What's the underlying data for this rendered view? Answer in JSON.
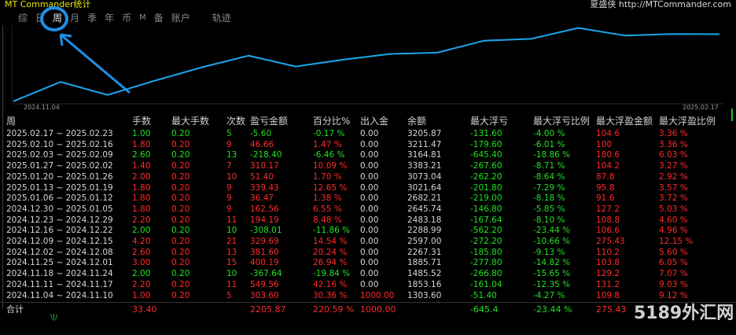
{
  "header": {
    "app_title": "MT Commander统计",
    "vendor": "夏盛侠 http://MTCommander.com"
  },
  "tabs": [
    {
      "label": "综",
      "active": false
    },
    {
      "label": "日",
      "active": false
    },
    {
      "label": "周",
      "active": true
    },
    {
      "label": "月",
      "active": false
    },
    {
      "label": "季",
      "active": false
    },
    {
      "label": "年",
      "active": false
    },
    {
      "label": "币",
      "active": false
    },
    {
      "label": "M",
      "active": false
    },
    {
      "label": "备",
      "active": false
    },
    {
      "label": "账户",
      "active": false
    },
    {
      "label": "轨迹",
      "active": false
    }
  ],
  "chart": {
    "start_date": "2024.11.04",
    "end_date": "2025.02.17",
    "line_color": "#1aa7ec",
    "values": [
      1303.6,
      1853.16,
      1485.52,
      1885.71,
      2267.31,
      2597.0,
      2288.99,
      2483.18,
      2645.74,
      2682.21,
      3021.64,
      3073.04,
      3383.21,
      3164.81,
      3211.47,
      3205.87
    ]
  },
  "table": {
    "columns": [
      "周",
      "手数",
      "最大手数",
      "次数",
      "盈亏金额",
      "百分比%",
      "出入金",
      "余额",
      "最大浮亏",
      "最大浮亏比例",
      "最大浮盈金额",
      "最大浮盈比例"
    ],
    "rows": [
      {
        "week": "2025.02.17 ~ 2025.02.23",
        "lots": "1.00",
        "max_lots": "0.20",
        "count": "5",
        "pnl": "-5.60",
        "pct": "-0.17 %",
        "flow": "0.00",
        "balance": "3205.87",
        "max_dd": "-131.60",
        "dd_pct": "-4.00 %",
        "max_fp": "104.6",
        "fp_pct": "3.36 %",
        "sign": "neg"
      },
      {
        "week": "2025.02.10 ~ 2025.02.16",
        "lots": "1.80",
        "max_lots": "0.20",
        "count": "9",
        "pnl": "46.66",
        "pct": "1.47 %",
        "flow": "0.00",
        "balance": "3211.47",
        "max_dd": "-179.60",
        "dd_pct": "-6.01 %",
        "max_fp": "100",
        "fp_pct": "3.36 %",
        "sign": "pos"
      },
      {
        "week": "2025.02.03 ~ 2025.02.09",
        "lots": "2.60",
        "max_lots": "0.20",
        "count": "13",
        "pnl": "-218.40",
        "pct": "-6.46 %",
        "flow": "0.00",
        "balance": "3164.81",
        "max_dd": "-645.40",
        "dd_pct": "-18.86 %",
        "max_fp": "180.6",
        "fp_pct": "6.03 %",
        "sign": "neg"
      },
      {
        "week": "2025.01.27 ~ 2025.02.02",
        "lots": "1.40",
        "max_lots": "0.20",
        "count": "7",
        "pnl": "310.17",
        "pct": "10.09 %",
        "flow": "0.00",
        "balance": "3383.21",
        "max_dd": "-267.60",
        "dd_pct": "-8.71 %",
        "max_fp": "104.2",
        "fp_pct": "3.27 %",
        "sign": "pos"
      },
      {
        "week": "2025.01.20 ~ 2025.01.26",
        "lots": "2.00",
        "max_lots": "0.20",
        "count": "10",
        "pnl": "51.40",
        "pct": "1.70 %",
        "flow": "0.00",
        "balance": "3073.04",
        "max_dd": "-262.20",
        "dd_pct": "-8.64 %",
        "max_fp": "87.8",
        "fp_pct": "2.92 %",
        "sign": "pos"
      },
      {
        "week": "2025.01.13 ~ 2025.01.19",
        "lots": "1.80",
        "max_lots": "0.20",
        "count": "9",
        "pnl": "339.43",
        "pct": "12.65 %",
        "flow": "0.00",
        "balance": "3021.64",
        "max_dd": "-201.80",
        "dd_pct": "-7.29 %",
        "max_fp": "95.8",
        "fp_pct": "3.57 %",
        "sign": "pos"
      },
      {
        "week": "2025.01.06 ~ 2025.01.12",
        "lots": "1.80",
        "max_lots": "0.20",
        "count": "9",
        "pnl": "36.47",
        "pct": "1.38 %",
        "flow": "0.00",
        "balance": "2682.21",
        "max_dd": "-219.00",
        "dd_pct": "-8.18 %",
        "max_fp": "91.6",
        "fp_pct": "3.72 %",
        "sign": "pos"
      },
      {
        "week": "2024.12.30 ~ 2025.01.05",
        "lots": "1.80",
        "max_lots": "0.20",
        "count": "9",
        "pnl": "162.56",
        "pct": "6.55 %",
        "flow": "0.00",
        "balance": "2645.74",
        "max_dd": "-146.80",
        "dd_pct": "-5.85 %",
        "max_fp": "127.2",
        "fp_pct": "5.03 %",
        "sign": "pos"
      },
      {
        "week": "2024.12.23 ~ 2024.12.29",
        "lots": "2.20",
        "max_lots": "0.20",
        "count": "11",
        "pnl": "194.19",
        "pct": "8.48 %",
        "flow": "0.00",
        "balance": "2483.18",
        "max_dd": "-167.64",
        "dd_pct": "-8.10 %",
        "max_fp": "108.8",
        "fp_pct": "4.60 %",
        "sign": "pos"
      },
      {
        "week": "2024.12.16 ~ 2024.12.22",
        "lots": "2.00",
        "max_lots": "0.20",
        "count": "10",
        "pnl": "-308.01",
        "pct": "-11.86 %",
        "flow": "0.00",
        "balance": "2288.99",
        "max_dd": "-562.20",
        "dd_pct": "-23.44 %",
        "max_fp": "106.6",
        "fp_pct": "4.96 %",
        "sign": "neg"
      },
      {
        "week": "2024.12.09 ~ 2024.12.15",
        "lots": "4.20",
        "max_lots": "0.20",
        "count": "21",
        "pnl": "329.69",
        "pct": "14.54 %",
        "flow": "0.00",
        "balance": "2597.00",
        "max_dd": "-272.20",
        "dd_pct": "-10.66 %",
        "max_fp": "275.43",
        "fp_pct": "12.15 %",
        "sign": "pos"
      },
      {
        "week": "2024.12.02 ~ 2024.12.08",
        "lots": "2.60",
        "max_lots": "0.20",
        "count": "13",
        "pnl": "381.60",
        "pct": "20.24 %",
        "flow": "0.00",
        "balance": "2267.31",
        "max_dd": "-185.80",
        "dd_pct": "-9.13 %",
        "max_fp": "110.2",
        "fp_pct": "5.60 %",
        "sign": "pos"
      },
      {
        "week": "2024.11.25 ~ 2024.12.01",
        "lots": "3.00",
        "max_lots": "0.20",
        "count": "15",
        "pnl": "400.19",
        "pct": "26.94 %",
        "flow": "0.00",
        "balance": "1885.71",
        "max_dd": "-277.80",
        "dd_pct": "-14.82 %",
        "max_fp": "103.8",
        "fp_pct": "6.05 %",
        "sign": "pos"
      },
      {
        "week": "2024.11.18 ~ 2024.11.24",
        "lots": "2.00",
        "max_lots": "0.20",
        "count": "10",
        "pnl": "-367.64",
        "pct": "-19.84 %",
        "flow": "0.00",
        "balance": "1485.52",
        "max_dd": "-266.80",
        "dd_pct": "-15.65 %",
        "max_fp": "129.2",
        "fp_pct": "7.07 %",
        "sign": "neg"
      },
      {
        "week": "2024.11.11 ~ 2024.11.17",
        "lots": "2.20",
        "max_lots": "0.20",
        "count": "11",
        "pnl": "549.56",
        "pct": "42.16 %",
        "flow": "0.00",
        "balance": "1853.16",
        "max_dd": "-161.04",
        "dd_pct": "-12.35 %",
        "max_fp": "131.2",
        "fp_pct": "9.03 %",
        "sign": "pos"
      },
      {
        "week": "2024.11.04 ~ 2024.11.10",
        "lots": "1.00",
        "max_lots": "0.20",
        "count": "5",
        "pnl": "303.60",
        "pct": "30.36 %",
        "flow": "1000.00",
        "balance": "1303.60",
        "max_dd": "-51.40",
        "dd_pct": "-4.27 %",
        "max_fp": "109.8",
        "fp_pct": "9.12 %",
        "sign": "pos"
      }
    ],
    "total": {
      "label": "合计",
      "lots": "33.40",
      "pnl": "2205.87",
      "pct": "220.59 %",
      "flow": "1000.00",
      "max_dd": "-645.4",
      "dd_pct": "-23.44 %",
      "max_fp": "275.43"
    }
  },
  "watermark": "5189外汇网"
}
